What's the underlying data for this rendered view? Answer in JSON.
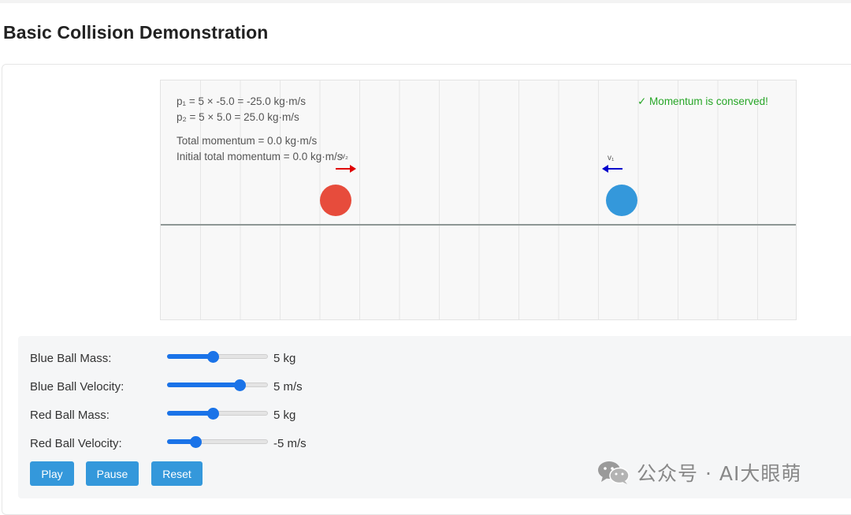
{
  "page": {
    "title": "Basic Collision Demonstration"
  },
  "simulation": {
    "p1_line": "p₁ = 5 × -5.0 = -25.0 kg·m/s",
    "p2_line": "p₂ = 5 × 5.0 = 25.0 kg·m/s",
    "total_line": "Total momentum = 0.0 kg·m/s",
    "initial_line": "Initial total momentum = 0.0 kg·m/s",
    "conserved_text": "✓ Momentum is conserved!",
    "red_velocity_label": "v₂",
    "blue_velocity_label": "v₁",
    "colors": {
      "red_ball": "#e74c3c",
      "blue_ball": "#3498db",
      "red_arrow": "#e00000",
      "blue_arrow": "#0000cc",
      "ground": "#8e9795",
      "conserved": "#27a627"
    }
  },
  "controls": {
    "rows": [
      {
        "label": "Blue Ball Mass:",
        "value_text": "5 kg",
        "fill": 0.45
      },
      {
        "label": "Blue Ball Velocity:",
        "value_text": "5 m/s",
        "fill": 0.72
      },
      {
        "label": "Red Ball Mass:",
        "value_text": "5 kg",
        "fill": 0.45
      },
      {
        "label": "Red Ball Velocity:",
        "value_text": "-5 m/s",
        "fill": 0.28
      }
    ],
    "buttons": {
      "play": "Play",
      "pause": "Pause",
      "reset": "Reset"
    }
  },
  "watermark": {
    "text": "公众号 · AI大眼萌"
  }
}
